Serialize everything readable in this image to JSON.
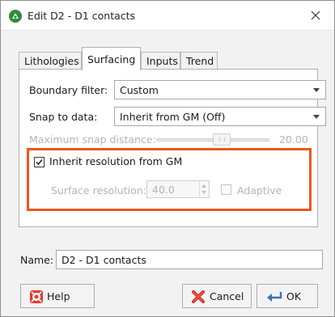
{
  "window": {
    "title": "Edit D2 - D1 contacts",
    "accent_color": "#f0541e"
  },
  "tabs": [
    {
      "label": "Lithologies",
      "active": false
    },
    {
      "label": "Surfacing",
      "active": true
    },
    {
      "label": "Inputs",
      "active": false
    },
    {
      "label": "Trend",
      "active": false
    }
  ],
  "surfacing": {
    "boundary_filter": {
      "label": "Boundary filter:",
      "value": "Custom"
    },
    "snap_to_data": {
      "label": "Snap to data:",
      "value": "Inherit from GM (Off)"
    },
    "max_snap_distance": {
      "label": "Maximum snap distance:",
      "value": "20.00",
      "slider_fraction": 0.5,
      "enabled": false
    },
    "inherit_resolution": {
      "label": "Inherit resolution from GM",
      "checked": true
    },
    "surface_resolution": {
      "label": "Surface resolution:",
      "value": "40.0",
      "enabled": false
    },
    "adaptive": {
      "label": "Adaptive",
      "checked": false,
      "enabled": false
    }
  },
  "name_field": {
    "label": "Name:",
    "value": "D2 - D1 contacts"
  },
  "buttons": {
    "help": {
      "label": "Help",
      "icon": "lifebuoy-icon"
    },
    "cancel": {
      "label": "Cancel",
      "icon": "red-x-icon"
    },
    "ok": {
      "label": "OK",
      "icon": "checkmark-arrow-icon"
    }
  }
}
